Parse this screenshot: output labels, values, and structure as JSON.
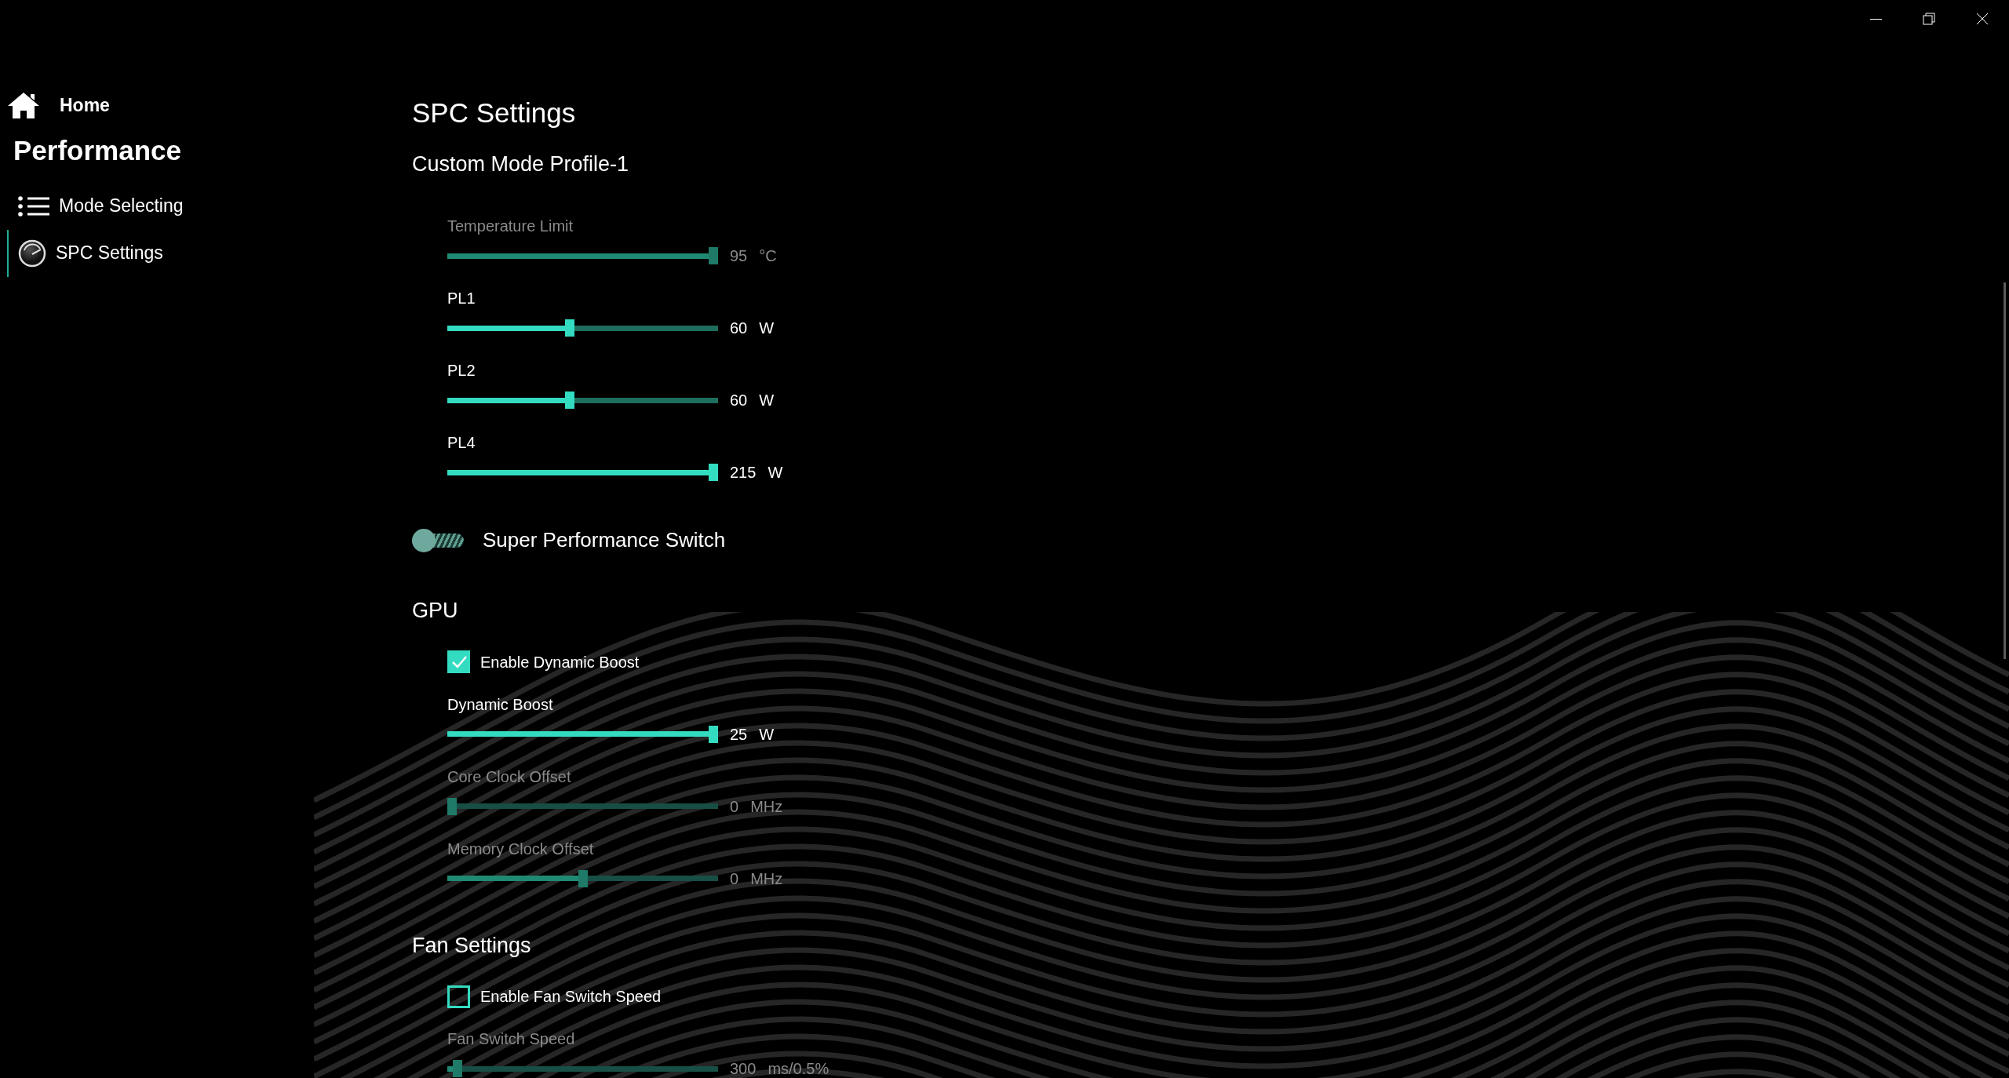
{
  "sidebar": {
    "home": {
      "label": "Home"
    },
    "heading": "Performance",
    "items": [
      {
        "label": "Mode Selecting",
        "selected": false
      },
      {
        "label": "SPC Settings",
        "selected": true
      }
    ]
  },
  "page_title": "SPC Settings",
  "sections": [
    {
      "heading": "Custom Mode Profile-1",
      "items": [
        {
          "kind": "slider",
          "label": "Temperature Limit",
          "level": 1,
          "value": "95",
          "unit": "°C",
          "disabled": true
        },
        {
          "kind": "slider",
          "label": "PL1",
          "level": 0.45,
          "value": "60",
          "unit": "W",
          "disabled": false
        },
        {
          "kind": "slider",
          "label": "PL2",
          "level": 0.45,
          "value": "60",
          "unit": "W",
          "disabled": false
        },
        {
          "kind": "slider",
          "label": "PL4",
          "level": 1,
          "value": "215",
          "unit": "W",
          "disabled": false
        },
        {
          "kind": "switch",
          "label": "Super Performance Switch",
          "on": false
        }
      ]
    },
    {
      "heading": "GPU",
      "items": [
        {
          "kind": "checkbox",
          "label": "Enable Dynamic Boost",
          "checked": true
        },
        {
          "kind": "slider",
          "label": "Dynamic Boost",
          "level": 1,
          "value": "25",
          "unit": "W",
          "disabled": false
        },
        {
          "kind": "slider",
          "label": "Core Clock Offset",
          "level": 0,
          "value": "0",
          "unit": "MHz",
          "disabled": true
        },
        {
          "kind": "slider",
          "label": "Memory Clock Offset",
          "level": 0.5,
          "value": "0",
          "unit": "MHz",
          "disabled": true
        }
      ]
    },
    {
      "heading": "Fan Settings",
      "items": [
        {
          "kind": "checkbox",
          "label": "Enable Fan Switch Speed",
          "checked": false
        },
        {
          "kind": "slider",
          "label": "Fan Switch Speed",
          "level": 0.02,
          "value": "300",
          "unit": "ms/0.5%",
          "disabled": true
        }
      ]
    }
  ]
}
